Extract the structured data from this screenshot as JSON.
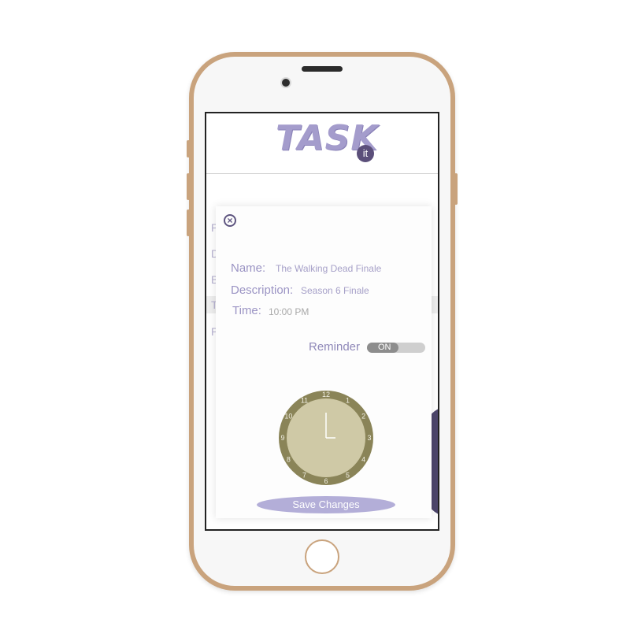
{
  "app": {
    "logo_text": "TASK",
    "logo_badge": "it"
  },
  "background_list": {
    "letters": [
      "P",
      "D",
      "B",
      "T",
      "P"
    ]
  },
  "modal": {
    "fields": {
      "name_label": "Name:",
      "name_value": "The Walking Dead Finale",
      "description_label": "Description:",
      "description_value": "Season 6 Finale",
      "time_label": "Time:",
      "time_value": "10:00 PM"
    },
    "reminder": {
      "label": "Reminder",
      "toggle_state": "ON"
    },
    "clock": {
      "numbers": [
        "12",
        "1",
        "2",
        "3",
        "4",
        "5",
        "6",
        "7",
        "8",
        "9",
        "10",
        "11"
      ]
    },
    "save_button_label": "Save Changes"
  },
  "colors": {
    "accent": "#b3aed8",
    "text_purple": "#9b94c4",
    "clock_face": "#cfc9a6",
    "clock_ring": "#8a8458",
    "phone_gold": "#c9a37d"
  }
}
